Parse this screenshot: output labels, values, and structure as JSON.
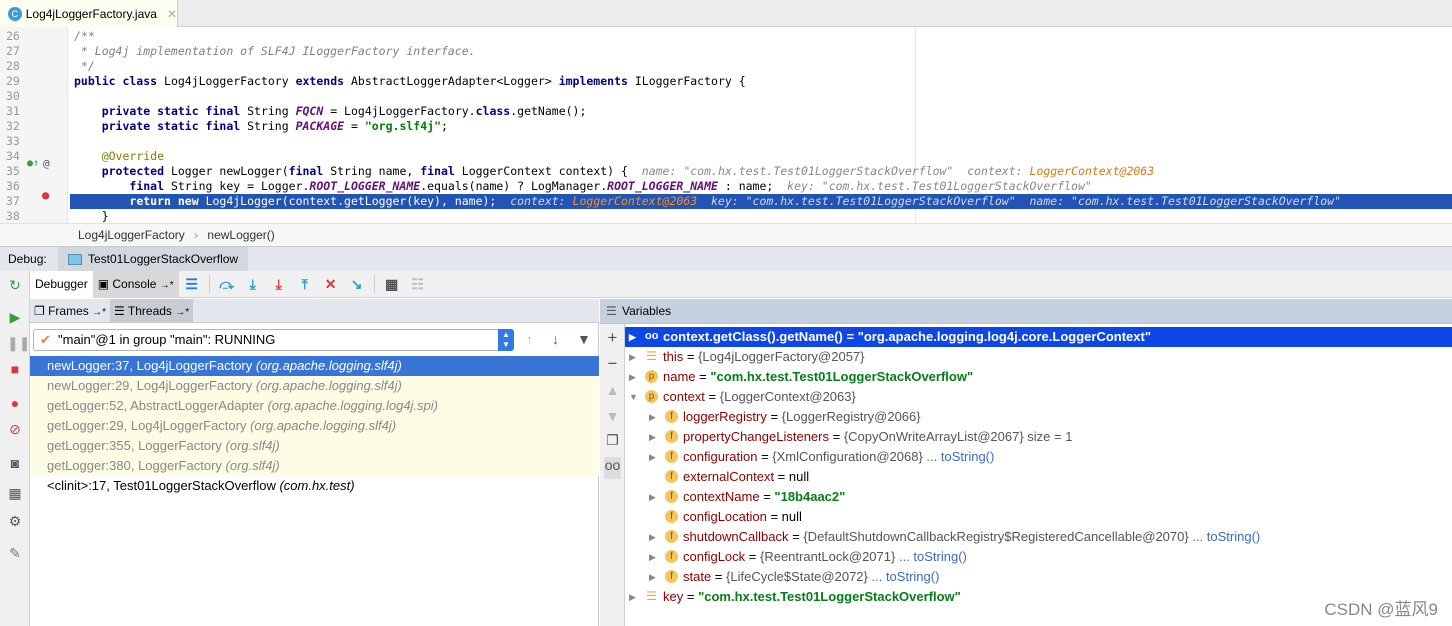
{
  "file_tab": {
    "icon": "class-icon",
    "icon_letter": "C",
    "label": "Log4jLoggerFactory.java"
  },
  "editor": {
    "lines": [
      {
        "n": "26",
        "segs": [
          [
            "cm",
            "/**"
          ]
        ]
      },
      {
        "n": "27",
        "segs": [
          [
            "cm",
            " * Log4j implementation of SLF4J ILoggerFactory interface."
          ]
        ]
      },
      {
        "n": "28",
        "segs": [
          [
            "cm",
            " */"
          ]
        ]
      },
      {
        "n": "29",
        "segs": [
          [
            "kw",
            "public class "
          ],
          [
            "",
            "Log4jLoggerFactory "
          ],
          [
            "kw",
            "extends "
          ],
          [
            "",
            "AbstractLoggerAdapter<Logger> "
          ],
          [
            "kw",
            "implements "
          ],
          [
            "",
            "ILoggerFactory {"
          ]
        ]
      },
      {
        "n": "30",
        "segs": []
      },
      {
        "n": "31",
        "segs": [
          [
            "",
            "    "
          ],
          [
            "kw",
            "private static final "
          ],
          [
            "",
            "String "
          ],
          [
            "fi",
            "FQCN"
          ],
          [
            "",
            " = Log4jLoggerFactory."
          ],
          [
            "kw",
            "class"
          ],
          [
            "",
            ".getName();"
          ]
        ]
      },
      {
        "n": "32",
        "segs": [
          [
            "",
            "    "
          ],
          [
            "kw",
            "private static final "
          ],
          [
            "",
            "String "
          ],
          [
            "fi",
            "PACKAGE"
          ],
          [
            "",
            " = "
          ],
          [
            "st",
            "\"org.slf4j\""
          ],
          [
            "",
            ";"
          ]
        ]
      },
      {
        "n": "33",
        "segs": []
      },
      {
        "n": "34",
        "segs": [
          [
            "an",
            "    @Override"
          ]
        ]
      },
      {
        "n": "35",
        "segs": [
          [
            "",
            "    "
          ],
          [
            "kw",
            "protected "
          ],
          [
            "",
            "Logger newLogger("
          ],
          [
            "kw",
            "final "
          ],
          [
            "",
            "String name, "
          ],
          [
            "kw",
            "final "
          ],
          [
            "",
            "LoggerContext context) {  "
          ],
          [
            "hint",
            "name: \"com.hx.test.Test01LoggerStackOverflow\"  context: "
          ],
          [
            "obj",
            "LoggerContext@2063"
          ]
        ]
      },
      {
        "n": "36",
        "segs": [
          [
            "",
            "        "
          ],
          [
            "kw",
            "final "
          ],
          [
            "",
            "String key = Logger."
          ],
          [
            "fi",
            "ROOT_LOGGER_NAME"
          ],
          [
            "",
            ".equals(name) ? LogManager."
          ],
          [
            "fi",
            "ROOT_LOGGER_NAME"
          ],
          [
            "",
            " : name;  "
          ],
          [
            "hint",
            "key: \"com.hx.test.Test01LoggerStackOverflow\""
          ]
        ]
      },
      {
        "n": "37",
        "segs": [
          [
            "",
            "        "
          ],
          [
            "kw",
            "return new "
          ],
          [
            "",
            "Log4jLogger(context.getLogger(key), name);  "
          ],
          [
            "hint",
            "context: "
          ],
          [
            "obj",
            "LoggerContext@2063"
          ],
          [
            "hint",
            "  key: \"com.hx.test.Test01LoggerStackOverflow\"  name: \"com.hx.test.Test01LoggerStackOverflow\""
          ]
        ]
      },
      {
        "n": "38",
        "segs": [
          [
            "",
            "    }"
          ]
        ]
      }
    ],
    "highlight_line": "37"
  },
  "breadcrumb": [
    "Log4jLoggerFactory",
    "newLogger()"
  ],
  "debug": {
    "label": "Debug:",
    "session": "Test01LoggerStackOverflow"
  },
  "toolbar": {
    "debugger_tab": "Debugger",
    "console_tab": "Console",
    "pin": "→*"
  },
  "frames": {
    "tab_frames": "Frames",
    "tab_threads": "Threads",
    "pin": "→*",
    "thread_select": "\"main\"@1 in group \"main\": RUNNING",
    "items": [
      {
        "m": "newLogger:37, Log4jLoggerFactory ",
        "p": "(org.apache.logging.slf4j)",
        "state": "sel"
      },
      {
        "m": "newLogger:29, Log4jLoggerFactory ",
        "p": "(org.apache.logging.slf4j)",
        "state": "lib"
      },
      {
        "m": "getLogger:52, AbstractLoggerAdapter ",
        "p": "(org.apache.logging.log4j.spi)",
        "state": "lib"
      },
      {
        "m": "getLogger:29, Log4jLoggerFactory ",
        "p": "(org.apache.logging.slf4j)",
        "state": "lib"
      },
      {
        "m": "getLogger:355, LoggerFactory ",
        "p": "(org.slf4j)",
        "state": "lib"
      },
      {
        "m": "getLogger:380, LoggerFactory ",
        "p": "(org.slf4j)",
        "state": "lib"
      },
      {
        "m": "<clinit>:17, Test01LoggerStackOverflow ",
        "p": "(com.hx.test)",
        "state": ""
      }
    ]
  },
  "variables": {
    "title": "Variables",
    "rows": [
      {
        "d": 0,
        "exp": "closed",
        "icon": "watch",
        "name": "context.getClass().getName()",
        "eq": " = ",
        "val": "\"org.apache.logging.log4j.core.LoggerContext\"",
        "vt": "s",
        "sel": true
      },
      {
        "d": 0,
        "exp": "closed",
        "icon": "list",
        "name": "this",
        "eq": " = ",
        "val": "{Log4jLoggerFactory@2057}",
        "vt": ""
      },
      {
        "d": 0,
        "exp": "closed",
        "icon": "p",
        "name": "name",
        "eq": " = ",
        "val": "\"com.hx.test.Test01LoggerStackOverflow\"",
        "vt": "s"
      },
      {
        "d": 0,
        "exp": "open",
        "icon": "p",
        "name": "context",
        "eq": " = ",
        "val": "{LoggerContext@2063}",
        "vt": ""
      },
      {
        "d": 1,
        "exp": "closed",
        "icon": "f",
        "name": "loggerRegistry",
        "eq": " = ",
        "val": "{LoggerRegistry@2066}",
        "vt": ""
      },
      {
        "d": 1,
        "exp": "closed",
        "icon": "f",
        "name": "propertyChangeListeners",
        "eq": " = ",
        "val": "{CopyOnWriteArrayList@2067}  size = 1",
        "vt": ""
      },
      {
        "d": 1,
        "exp": "closed",
        "icon": "f",
        "name": "configuration",
        "eq": " = ",
        "val": "{XmlConfiguration@2068}",
        "vt": "",
        "link": "... toString()"
      },
      {
        "d": 1,
        "exp": "none",
        "icon": "f",
        "name": "externalContext",
        "eq": " = ",
        "val": "null",
        "vt": ""
      },
      {
        "d": 1,
        "exp": "closed",
        "icon": "f",
        "name": "contextName",
        "eq": " = ",
        "val": "\"18b4aac2\"",
        "vt": "s"
      },
      {
        "d": 1,
        "exp": "none",
        "icon": "f",
        "name": "configLocation",
        "eq": " = ",
        "val": "null",
        "vt": ""
      },
      {
        "d": 1,
        "exp": "closed",
        "icon": "f",
        "name": "shutdownCallback",
        "eq": " = ",
        "val": "{DefaultShutdownCallbackRegistry$RegisteredCancellable@2070}",
        "vt": "",
        "link": "... toString()"
      },
      {
        "d": 1,
        "exp": "closed",
        "icon": "f",
        "name": "configLock",
        "eq": " = ",
        "val": "{ReentrantLock@2071}",
        "vt": "",
        "link": "... toString()"
      },
      {
        "d": 1,
        "exp": "closed",
        "icon": "f",
        "name": "state",
        "eq": " = ",
        "val": "{LifeCycle$State@2072}",
        "vt": "",
        "link": "... toString()"
      },
      {
        "d": 0,
        "exp": "closed",
        "icon": "list",
        "name": "key",
        "eq": " = ",
        "val": "\"com.hx.test.Test01LoggerStackOverflow\"",
        "vt": "s"
      }
    ]
  },
  "watermark": "CSDN @蓝风9"
}
